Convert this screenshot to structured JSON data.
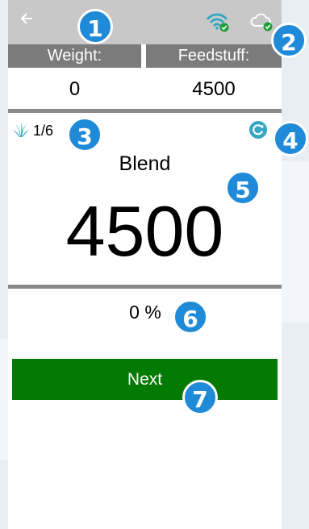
{
  "header": {
    "weight_label": "Weight:",
    "feedstuff_label": "Feedstuff:",
    "weight_value": "0",
    "feedstuff_value": "4500"
  },
  "main": {
    "counter": "1/6",
    "mode_label": "Blend",
    "amount": "4500",
    "percent": "0 %"
  },
  "actions": {
    "next_label": "Next"
  },
  "callouts": [
    "1",
    "2",
    "3",
    "4",
    "5",
    "6",
    "7"
  ],
  "icons": [
    "back-arrow-icon",
    "wifi-icon",
    "cloud-icon",
    "grass-icon",
    "refresh-icon"
  ],
  "colors": {
    "status_bar": "#c8c8c8",
    "header_bar": "#7b7b7b",
    "accent_teal": "#35a7c2",
    "status_ok": "#1e9e3a",
    "next_button": "#037a03",
    "callout": "#1f8ad8"
  }
}
